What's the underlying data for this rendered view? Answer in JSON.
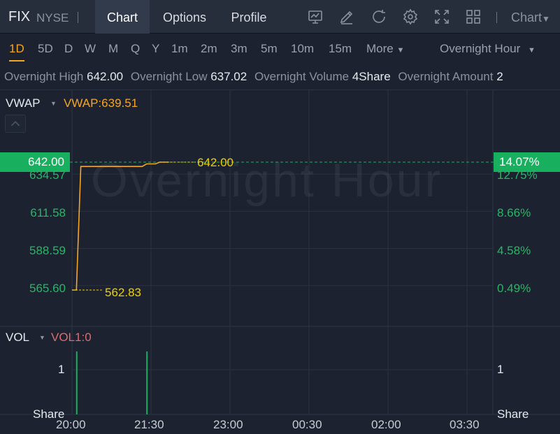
{
  "header": {
    "symbol": "FIX",
    "exchange": "NYSE",
    "tabs": [
      "Chart",
      "Options",
      "Profile"
    ],
    "chart_dropdown": "Chart"
  },
  "periods": {
    "items": [
      "1D",
      "5D",
      "D",
      "W",
      "M",
      "Q",
      "Y",
      "1m",
      "2m",
      "3m",
      "5m",
      "10m",
      "15m"
    ],
    "active": "1D",
    "more_label": "More",
    "session": "Overnight Hour"
  },
  "stats": {
    "high_label": "Overnight High",
    "high_value": "642.00",
    "low_label": "Overnight Low",
    "low_value": "637.02",
    "volume_label": "Overnight Volume",
    "volume_value": "4Share",
    "amount_label": "Overnight Amount",
    "amount_value": "2"
  },
  "main_chart": {
    "indicator_name": "VWAP",
    "indicator_value": "VWAP:639.51",
    "watermark": "Overnight Hour",
    "current_price": "642.00",
    "current_pct": "14.07%",
    "y_left": [
      "634.57",
      "611.58",
      "588.59",
      "565.60"
    ],
    "y_right": [
      "12.75%",
      "8.66%",
      "4.58%",
      "0.49%"
    ],
    "high_mark": "642.00",
    "low_mark": "562.83"
  },
  "volume_chart": {
    "indicator_name": "VOL",
    "indicator_value": "VOL1:0",
    "y_left": "1",
    "y_right": "1",
    "unit_left": "Share",
    "unit_right": "Share"
  },
  "time_axis": [
    "20:00",
    "21:30",
    "23:00",
    "00:30",
    "02:00",
    "03:30"
  ],
  "colors": {
    "accent": "#f5a623",
    "up_green": "#18b05e",
    "price_line": "#f5a623",
    "vol_name": "#e06c6c",
    "mark_yellow": "#f0d000"
  },
  "chart_data": {
    "type": "line",
    "series": [
      {
        "x": [
          "20:00",
          "20:05",
          "20:10",
          "21:20",
          "21:25",
          "21:35",
          "21:40",
          "21:50"
        ],
        "values": [
          562.83,
          562.83,
          639.3,
          639.3,
          640.9,
          640.9,
          642.0,
          642.0
        ]
      }
    ],
    "volume": {
      "x": [
        "20:05",
        "21:25"
      ],
      "values": [
        2,
        2
      ]
    },
    "ylim": [
      555.0,
      646.0
    ],
    "ticks_left": [
      634.57,
      611.58,
      588.59,
      565.6
    ],
    "ticks_right_pct": [
      12.75,
      8.66,
      4.58,
      0.49
    ],
    "time_ticks": [
      "20:00",
      "21:30",
      "23:00",
      "00:30",
      "02:00",
      "03:30"
    ]
  }
}
